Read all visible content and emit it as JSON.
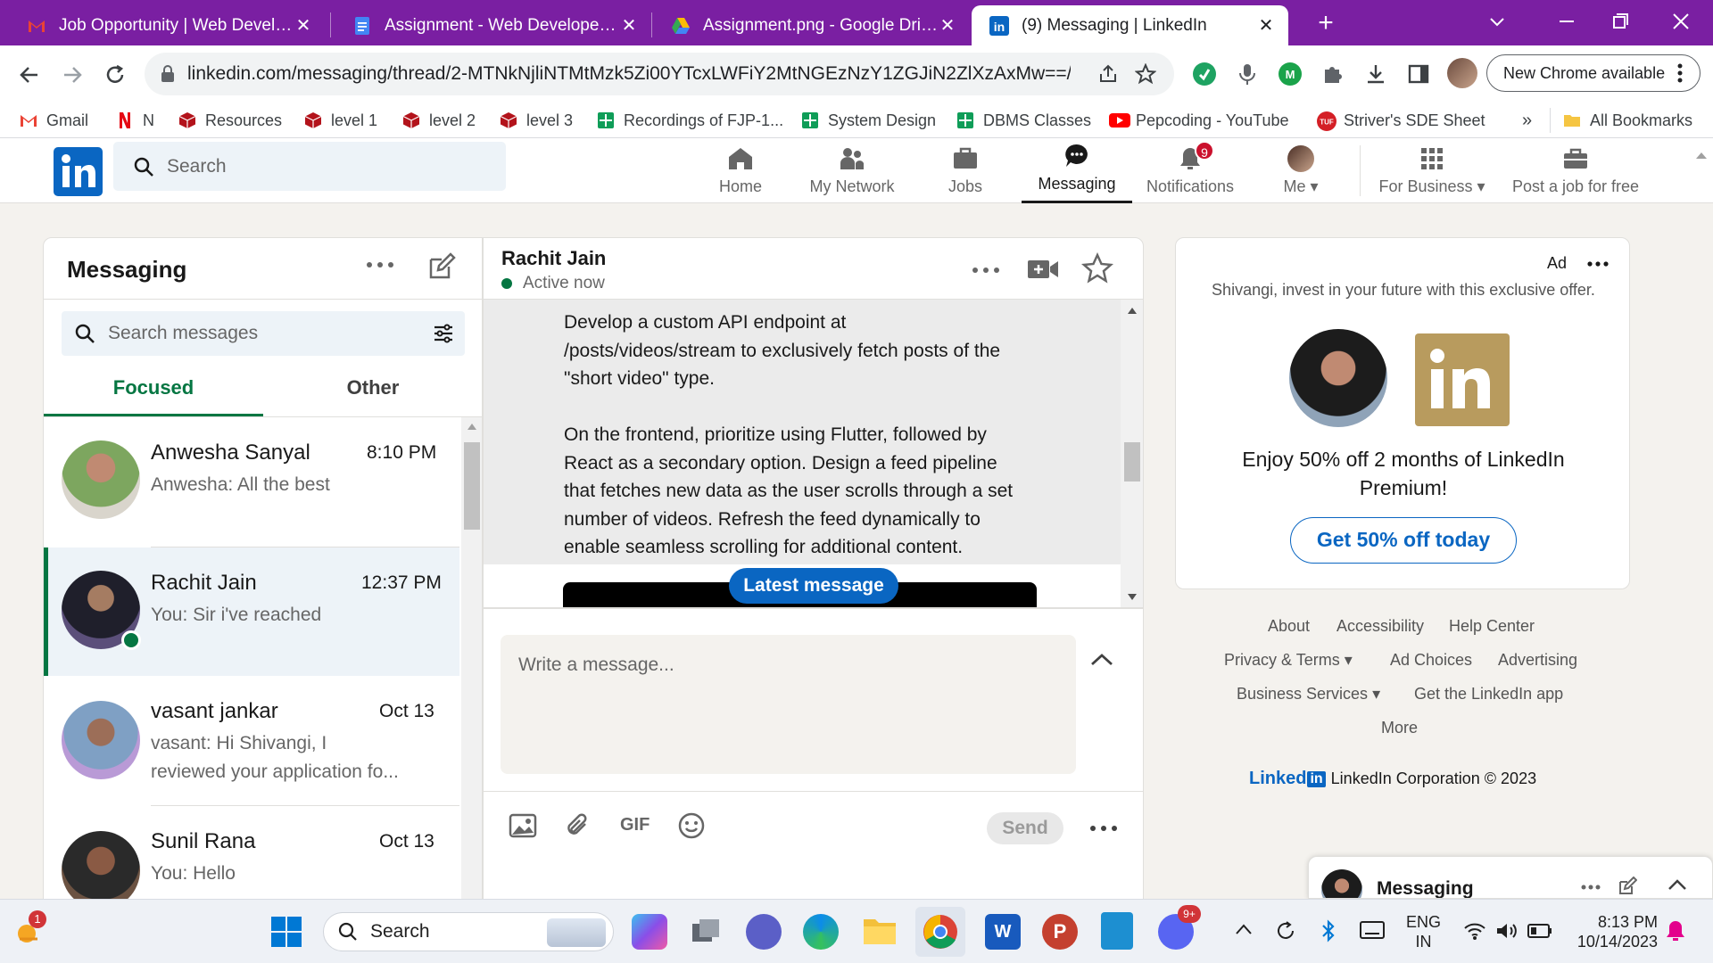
{
  "browser": {
    "tabs": [
      {
        "title": "Job Opportunity | Web Develope",
        "icon": "gmail-icon",
        "active": false
      },
      {
        "title": "Assignment - Web Developer.dc",
        "icon": "google-docs-icon",
        "active": false
      },
      {
        "title": "Assignment.png - Google Drive",
        "icon": "google-drive-icon",
        "active": false
      },
      {
        "title": "(9) Messaging | LinkedIn",
        "icon": "linkedin-icon",
        "active": true
      }
    ],
    "new_tab_label": "+",
    "url": "linkedin.com/messaging/thread/2-MTNkNjliNTMtMzk5Zi00YTcxLWFiY2MtNGEzNzY1ZGJiN2ZlXzAxMw==/",
    "new_chrome_label": "New Chrome available",
    "bookmarks": [
      {
        "label": "Gmail",
        "icon": "gmail-icon"
      },
      {
        "label": "N",
        "icon": "netflix-icon"
      },
      {
        "label": "Resources",
        "icon": "cube-icon"
      },
      {
        "label": "level 1",
        "icon": "cube-icon"
      },
      {
        "label": "level 2",
        "icon": "cube-icon"
      },
      {
        "label": "level 3",
        "icon": "cube-icon"
      },
      {
        "label": "Recordings of FJP-1...",
        "icon": "sheets-icon"
      },
      {
        "label": "System Design",
        "icon": "sheets-icon"
      },
      {
        "label": "DBMS Classes",
        "icon": "sheets-icon"
      },
      {
        "label": "Pepcoding - YouTube",
        "icon": "youtube-icon"
      },
      {
        "label": "Striver's SDE Sheet",
        "icon": "tuf-icon"
      }
    ],
    "bookmarks_overflow": "»",
    "all_bookmarks": "All Bookmarks"
  },
  "linkedin": {
    "search_placeholder": "Search",
    "nav": [
      {
        "label": "Home",
        "icon": "home-icon"
      },
      {
        "label": "My Network",
        "icon": "network-icon"
      },
      {
        "label": "Jobs",
        "icon": "briefcase-icon"
      },
      {
        "label": "Messaging",
        "icon": "messaging-icon",
        "active": true
      },
      {
        "label": "Notifications",
        "icon": "bell-icon",
        "badge": "9"
      },
      {
        "label": "Me",
        "icon": "avatar-icon"
      },
      {
        "label": "For Business",
        "icon": "grid-icon"
      },
      {
        "label": "Post a job for free",
        "icon": "briefcase-plus-icon"
      }
    ]
  },
  "messaging": {
    "title": "Messaging",
    "search_placeholder": "Search messages",
    "tabs": [
      "Focused",
      "Other"
    ],
    "conversations": [
      {
        "name": "Anwesha Sanyal",
        "time": "8:10 PM",
        "preview": "Anwesha: All the best",
        "preview2": ""
      },
      {
        "name": "Rachit Jain",
        "time": "12:37 PM",
        "preview": "You: Sir i've reached",
        "preview2": "",
        "selected": true,
        "online": true
      },
      {
        "name": "vasant jankar",
        "time": "Oct 13",
        "preview": "vasant: Hi Shivangi, I",
        "preview2": "reviewed your application fo..."
      },
      {
        "name": "Sunil Rana",
        "time": "Oct 13",
        "preview": "You: Hello",
        "preview2": ""
      }
    ]
  },
  "thread": {
    "name": "Rachit Jain",
    "status": "Active now",
    "message_lines": [
      "Develop a custom API endpoint at",
      "/posts/videos/stream to exclusively fetch posts of the",
      "\"short video\" type.",
      "",
      "On the frontend, prioritize using Flutter, followed by",
      "React as a secondary option. Design a feed pipeline",
      "that fetches new data as the user scrolls through a set",
      "number of videos. Refresh the feed dynamically to",
      "enable seamless scrolling for additional content."
    ],
    "latest_message_label": "Latest message",
    "compose_placeholder": "Write a message...",
    "gif_label": "GIF",
    "send_label": "Send"
  },
  "ad": {
    "label": "Ad",
    "text": "Shivangi, invest in your future with this exclusive offer.",
    "headline": "Enjoy 50% off 2 months of LinkedIn Premium!",
    "cta": "Get 50% off today"
  },
  "footer": {
    "links_row1": [
      "About",
      "Accessibility",
      "Help Center"
    ],
    "links_row2": [
      "Privacy & Terms",
      "Ad Choices",
      "Advertising"
    ],
    "links_row3": [
      "Business Services",
      "Get the LinkedIn app"
    ],
    "more": "More",
    "brand": "Linked",
    "copyright": "LinkedIn Corporation © 2023"
  },
  "mini_messaging": {
    "label": "Messaging"
  },
  "taskbar": {
    "search_placeholder": "Search",
    "weather_badge": "1",
    "discord_badge": "9+",
    "lang_line1": "ENG",
    "lang_line2": "IN",
    "time": "8:13 PM",
    "date": "10/14/2023"
  },
  "colors": {
    "chrome_purple": "#7a1fa2",
    "linkedin_blue": "#0a66c2",
    "online_green": "#057642",
    "page_bg": "#f4f2ee"
  }
}
